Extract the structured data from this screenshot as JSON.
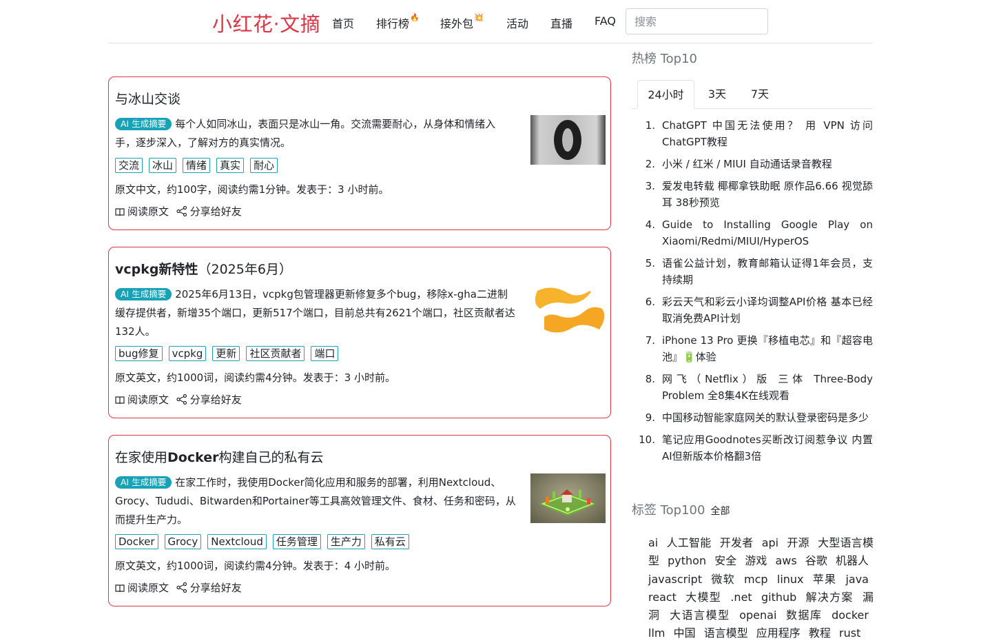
{
  "brand": "小红花·文摘",
  "nav": {
    "home": "首页",
    "ranking": "排行榜",
    "outsourcing": "接外包",
    "activity": "活动",
    "live": "直播",
    "faq": "FAQ"
  },
  "search": {
    "placeholder": "搜索"
  },
  "common": {
    "ai_badge": "AI 生成摘要",
    "read_original": "阅读原文",
    "share": "分享给好友"
  },
  "articles": [
    {
      "title": "与冰山交谈",
      "summary": "每个人如同冰山，表面只是冰山一角。交流需要耐心，从身体和情绪入手，逐步深入，了解对方的真实情况。",
      "tags": [
        "交流",
        "冰山",
        "情绪",
        "真实",
        "耐心"
      ],
      "meta": "原文中文，约100字，阅读约需1分钟。发表于：3 小时前。"
    },
    {
      "title_bold": "vcpkg新特性",
      "title_rest": "（2025年6月）",
      "summary": "2025年6月13日，vcpkg包管理器更新修复多个bug，移除x-gha二进制缓存提供者，新增35个端口，更新517个端口，目前总共有2621个端口，社区贡献者达132人。",
      "tags": [
        "bug修复",
        "vcpkg",
        "更新",
        "社区贡献者",
        "端口"
      ],
      "meta": "原文英文，约1000词，阅读约需4分钟。发表于：3 小时前。"
    },
    {
      "title_pre": "在家使用",
      "title_bold": "Docker",
      "title_post": "构建自己的私有云",
      "summary": "在家工作时，我使用Docker简化应用和服务的部署，利用Nextcloud、Grocy、Tududi、Bitwarden和Portainer等工具高效管理文件、食材、任务和密码，从而提升生产力。",
      "tags": [
        "Docker",
        "Grocy",
        "Nextcloud",
        "任务管理",
        "生产力",
        "私有云"
      ],
      "meta": "原文英文，约1000词，阅读约需4分钟。发表于：4 小时前。"
    }
  ],
  "sidebar": {
    "hot_title": "热榜 Top10",
    "tabs": [
      "24小时",
      "3天",
      "7天"
    ],
    "hot": [
      {
        "num": "1.",
        "text": "ChatGPT 中国无法使用？ 用 VPN 访问 ChatGPT教程"
      },
      {
        "num": "2.",
        "text": "小米 / 红米 / MIUI 自动通话录音教程"
      },
      {
        "num": "3.",
        "text": "爱发电转载 椰椰拿铁助眠 原作品6.66 视觉舔耳 38秒预览"
      },
      {
        "num": "4.",
        "text": "Guide to Installing Google Play on Xiaomi/Redmi/MIUI/HyperOS"
      },
      {
        "num": "5.",
        "text": "语雀公益计划，教育邮箱认证得1年会员，支持续期"
      },
      {
        "num": "6.",
        "text": "彩云天气和彩云小译均调整API价格 基本已经取消免费API计划"
      },
      {
        "num": "7.",
        "text": "iPhone 13 Pro 更换『移植电芯』和『超容电池』🔋体验"
      },
      {
        "num": "8.",
        "text": "网飞（Netflix）版 三体 Three-Body Problem 全8集4K在线观看"
      },
      {
        "num": "9.",
        "text": "中国移动智能家庭网关的默认登录密码是多少"
      },
      {
        "num": "10.",
        "text": "笔记应用Goodnotes买断改订阅惹争议 内置AI但新版本价格翻3倍"
      }
    ],
    "tags_title": "标签 Top100",
    "tags_all": "全部",
    "tag_cloud": [
      "ai",
      "人工智能",
      "开发者",
      "api",
      "开源",
      "大型语言模型",
      "python",
      "安全",
      "游戏",
      "aws",
      "谷歌",
      "机器人",
      "javascript",
      "微软",
      "mcp",
      "linux",
      "苹果",
      "java",
      "react",
      "大模型",
      ".net",
      "github",
      "解决方案",
      "漏洞",
      "大语言模型",
      "openai",
      "数据库",
      "docker",
      "llm",
      "中国",
      "语言模型",
      "应用程序",
      "教程",
      "rust"
    ]
  }
}
